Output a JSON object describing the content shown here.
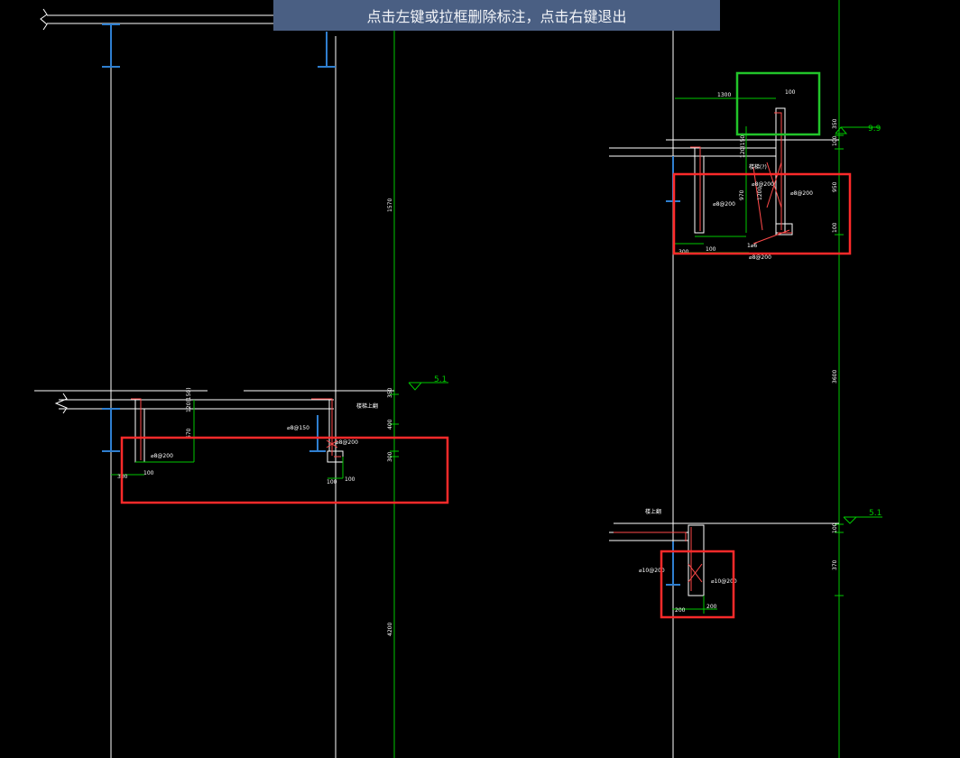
{
  "banner": {
    "text": "点击左键或拉框删除标注，点击右键退出"
  },
  "colors": {
    "background": "#000000",
    "axis": "#ffffff",
    "level_line": "#00c800",
    "dimension": "#00c800",
    "rebar": "#ff4a4a",
    "column": "#2f7fd0",
    "selection_box": "#ff2a2a",
    "highlight_box": "#22c42a",
    "banner_bg": "#4a5f83"
  },
  "drawing": {
    "level_marks": [
      {
        "id": "top-right",
        "label": "9.9"
      },
      {
        "id": "mid-left",
        "label": "5.1"
      },
      {
        "id": "lower-right",
        "label": "5.1"
      }
    ],
    "vertical_dims": {
      "left_upper": "1570",
      "left_lower": "4200",
      "right_middle": "3600",
      "left_350": "350",
      "left_300": "300",
      "left_400": "400",
      "right_350": "350",
      "right_100": "100",
      "right_950": "950",
      "right_100b": "100",
      "lower_100": "100",
      "lower_370": "370"
    },
    "left_detail": {
      "labels": [
        "120(150)",
        "670",
        "⌀8@200",
        "100",
        "300",
        "⌀8@150",
        "⌀8@200",
        "100",
        "100",
        "楼梯上翻"
      ]
    },
    "right_top_detail": {
      "labels": [
        "1300",
        "100",
        "120(150)",
        "楼梯(?)",
        "⌀8@200",
        "⌀8@200",
        "970",
        "⌀8@200",
        "1200",
        "300",
        "100",
        "1⌀6",
        "⌀8@200"
      ]
    },
    "right_lower_detail": {
      "labels": [
        "楼上翻",
        "⌀10@200",
        "⌀10@200",
        "200",
        "200"
      ]
    }
  }
}
